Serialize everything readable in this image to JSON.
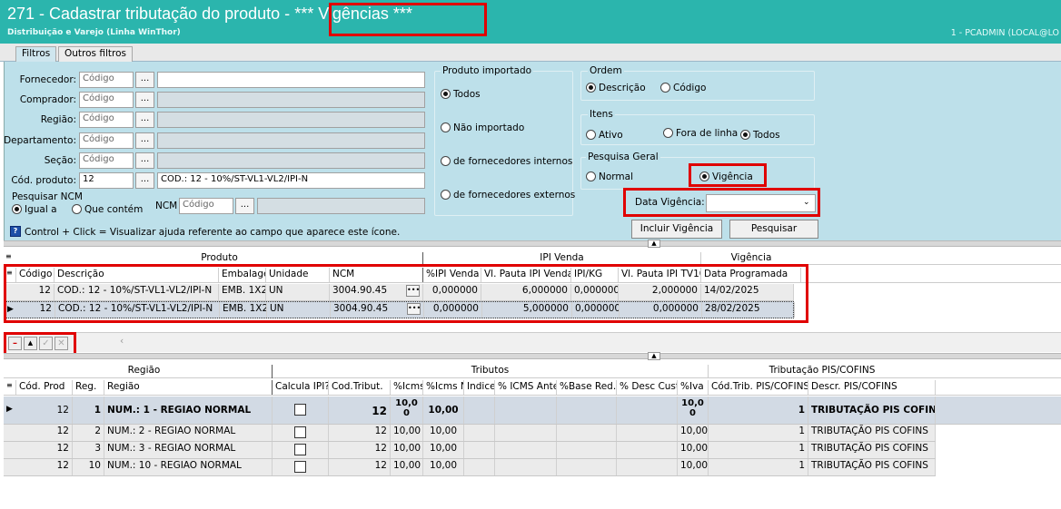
{
  "window": {
    "title_main": "271 - Cadastrar tributação do produto - ",
    "title_suffix": "*** Vigências ***",
    "subtitle": "Distribuição e Varejo (Linha WinThor)",
    "user": "1 - PCADMIN (LOCAL@LO"
  },
  "tabs": [
    {
      "label": "Filtros"
    },
    {
      "label": "Outros filtros"
    }
  ],
  "filters": {
    "fornecedor": {
      "label": "Fornecedor:",
      "placeholder": "Código"
    },
    "comprador": {
      "label": "Comprador:",
      "placeholder": "Código"
    },
    "regiao": {
      "label": "Região:",
      "placeholder": "Código"
    },
    "departamento": {
      "label": "Departamento:",
      "placeholder": "Código"
    },
    "secao": {
      "label": "Seção:",
      "placeholder": "Código"
    },
    "cod_produto": {
      "label": "Cód. produto:",
      "value": "12",
      "desc": "COD.: 12 - 10%/ST-VL1-VL2/IPI-N"
    },
    "pesquisar_ncm": {
      "label": "Pesquisar NCM",
      "opt1": "Igual a",
      "opt2": "Que contém",
      "ncm_label": "NCM",
      "ncm_placeholder": "Código"
    },
    "ellipsis": "...",
    "help_text": "Control + Click = Visualizar ajuda referente ao campo que aparece este ícone."
  },
  "produto_importado": {
    "title": "Produto importado",
    "options": [
      "Todos",
      "Não importado",
      "de fornecedores internos",
      "de fornecedores externos"
    ]
  },
  "ordem": {
    "title": "Ordem",
    "options": [
      "Descrição",
      "Código"
    ]
  },
  "itens": {
    "title": "Itens",
    "options": [
      "Ativo",
      "Fora de linha",
      "Todos"
    ]
  },
  "pesquisa_geral": {
    "title": "Pesquisa Geral",
    "options": [
      "Normal",
      "Vigência"
    ]
  },
  "data_vigencia": {
    "label": "Data Vigência:",
    "value": ""
  },
  "actions": {
    "incluir": "Incluir Vigência",
    "pesquisar": "Pesquisar"
  },
  "grid1": {
    "groups": [
      "Produto",
      "IPI Venda",
      "Vigência"
    ],
    "columns": [
      "Código",
      "Descrição",
      "Embalagem",
      "Unidade",
      "NCM",
      "%IPI Venda",
      "Vl. Pauta IPI Venda",
      "IPI/KG",
      "Vl. Pauta IPI TV10",
      "Data Programada"
    ],
    "rows": [
      [
        "12",
        "COD.: 12 - 10%/ST-VL1-VL2/IPI-N",
        "EMB. 1X24",
        "UN",
        "3004.90.45",
        "0,000000",
        "6,000000",
        "0,000000",
        "2,000000",
        "14/02/2025"
      ],
      [
        "12",
        "COD.: 12 - 10%/ST-VL1-VL2/IPI-N",
        "EMB. 1X24",
        "UN",
        "3004.90.45",
        "0,000000",
        "5,000000",
        "0,000000",
        "0,000000",
        "28/02/2025"
      ]
    ]
  },
  "grid2": {
    "groups": [
      "Região",
      "Tributos",
      "Tributação PIS/COFINS"
    ],
    "columns": [
      "Cód. Prod",
      "Reg.",
      "Região",
      "Calcula IPI?",
      "Cod.Tribut.",
      "%Icms",
      "%Icms Nota",
      "Indice",
      "% ICMS Ante",
      "%Base Red.",
      "% Desc Custo",
      "%Iva",
      "Cód.Trib. PIS/COFINS",
      "Descr. PIS/COFINS"
    ],
    "rows": [
      [
        "12",
        "1",
        "NUM.: 1 - REGIAO NORMAL",
        "12",
        "10,00",
        "10,00",
        "10,00",
        "1",
        "TRIBUTAÇÃO PIS COFINS"
      ],
      [
        "12",
        "2",
        "NUM.: 2 - REGIAO NORMAL",
        "12",
        "10,00",
        "10,00",
        "10,00",
        "1",
        "TRIBUTAÇÃO PIS COFINS"
      ],
      [
        "12",
        "3",
        "NUM.: 3 - REGIAO NORMAL",
        "12",
        "10,00",
        "10,00",
        "10,00",
        "1",
        "TRIBUTAÇÃO PIS COFINS"
      ],
      [
        "12",
        "10",
        "NUM.: 10 - REGIAO NORMAL",
        "12",
        "10,00",
        "10,00",
        "10,00",
        "1",
        "TRIBUTAÇÃO PIS COFINS"
      ]
    ]
  },
  "colors": {
    "titlebar": "#2bb5ad",
    "panel": "#bde0ea",
    "highlight": "#e00000"
  }
}
